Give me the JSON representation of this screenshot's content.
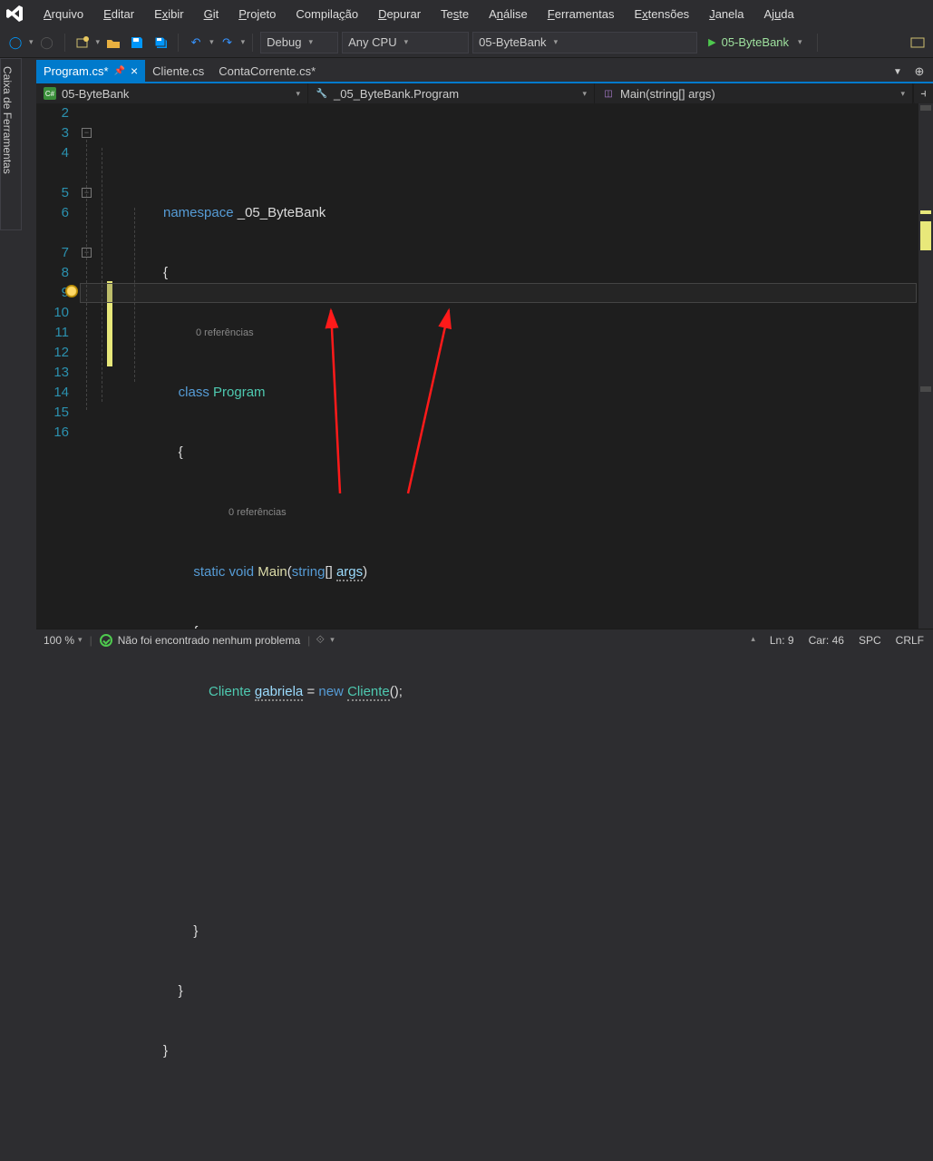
{
  "menu": {
    "items": [
      {
        "full": "Arquivo",
        "u": "A",
        "rest": "rquivo"
      },
      {
        "full": "Editar",
        "u": "E",
        "rest": "ditar"
      },
      {
        "full": "Exibir",
        "u": "",
        "rest": "Exibir",
        "u2": "x",
        "pre": "E",
        "post": "ibir"
      },
      {
        "full": "Git",
        "u": "G",
        "rest": "it"
      },
      {
        "full": "Projeto",
        "u": "P",
        "rest": "rojeto"
      },
      {
        "full": "Compilação",
        "u": "",
        "pre": "Compila",
        "u2": "ç",
        "post": "ão"
      },
      {
        "full": "Depurar",
        "u": "D",
        "rest": "epurar"
      },
      {
        "full": "Teste",
        "u": "",
        "pre": "Te",
        "u2": "s",
        "post": "te"
      },
      {
        "full": "Análise",
        "u": "",
        "pre": "A",
        "u2": "n",
        "post": "álise"
      },
      {
        "full": "Ferramentas",
        "u": "F",
        "rest": "erramentas"
      },
      {
        "full": "Extensões",
        "u": "",
        "pre": "E",
        "u2": "x",
        "post": "tensões"
      },
      {
        "full": "Janela",
        "u": "J",
        "rest": "anela"
      },
      {
        "full": "Ajuda",
        "u": "",
        "pre": "Aj",
        "u2": "u",
        "post": "da"
      }
    ]
  },
  "toolbar": {
    "config": "Debug",
    "platform": "Any CPU",
    "startup": "05-ByteBank",
    "run_label": "05-ByteBank"
  },
  "toolbox_label": "Caixa de Ferramentas",
  "tabs": [
    {
      "name": "Program.cs*",
      "active": true,
      "pinned": true
    },
    {
      "name": "Cliente.cs",
      "active": false,
      "pinned": false
    },
    {
      "name": "ContaCorrente.cs*",
      "active": false,
      "pinned": false
    }
  ],
  "crumbs": {
    "project": "05-ByteBank",
    "class": "_05_ByteBank.Program",
    "member": "Main(string[] args)"
  },
  "editor": {
    "line_numbers": [
      "2",
      "3",
      "4",
      "5",
      "6",
      "7",
      "8",
      "9",
      "10",
      "11",
      "12",
      "13",
      "14",
      "15",
      "16"
    ],
    "codelens1": "0 referências",
    "codelens2": "0 referências",
    "code": {
      "ns": "namespace",
      "nsname": "_05_ByteBank",
      "cls_kw": "class",
      "cls_name": "Program",
      "static": "static",
      "void": "void",
      "main": "Main",
      "strtype": "string",
      "args": "args",
      "cliente": "Cliente",
      "var": "gabriela",
      "new": "new",
      "cliente2": "Cliente"
    }
  },
  "status": {
    "zoom": "100 %",
    "problems": "Não foi encontrado nenhum problema",
    "ln_label": "Ln:",
    "ln": "9",
    "col_label": "Car:",
    "col": "46",
    "spc": "SPC",
    "crlf": "CRLF"
  }
}
